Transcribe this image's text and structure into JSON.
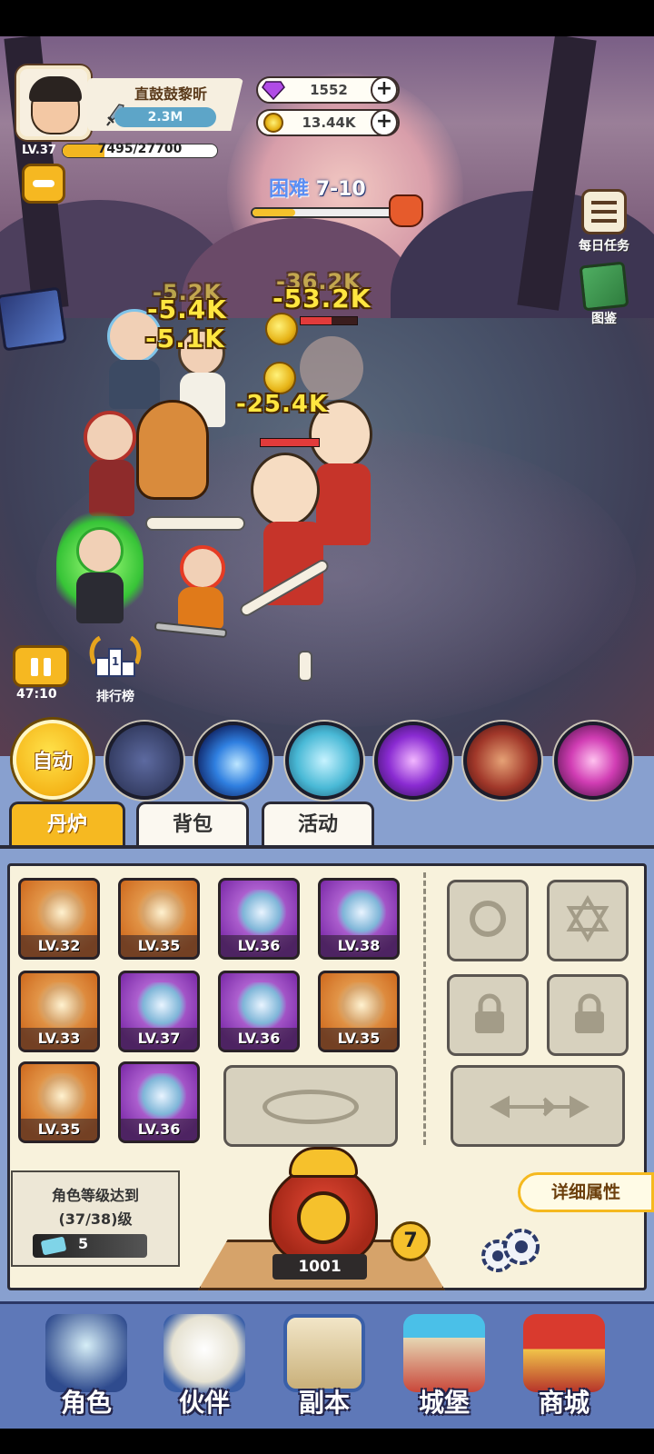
{
  "player": {
    "name": "直鼓鼓黎昕",
    "power": "2.3M",
    "level": "LV.37",
    "exp": "7495/27700",
    "exp_fraction": 0.27
  },
  "resources": {
    "gems": "1552",
    "coins": "13.44K"
  },
  "stage": {
    "difficulty": "困难",
    "number": "7-10",
    "progress_fraction": 0.3
  },
  "side_menu": {
    "daily_tasks": "每日任务",
    "codex": "图鉴"
  },
  "battle": {
    "damage_numbers": [
      "-5.2K",
      "-5.4K",
      "-5.1K",
      "-36.2K",
      "-53.2K",
      "-25.4K"
    ],
    "timer": "47:10",
    "rank_label": "排行榜"
  },
  "skills": {
    "auto_label": "自动",
    "icons": [
      "lightning-rune-icon",
      "blue-comet-icon",
      "ice-qilin-icon",
      "purple-vortex-icon",
      "wolf-beast-icon",
      "pink-spiral-icon"
    ]
  },
  "tabs": [
    {
      "label": "丹炉",
      "active": true
    },
    {
      "label": "背包",
      "active": false
    },
    {
      "label": "活动",
      "active": false
    }
  ],
  "inventory": [
    {
      "level": "LV.32",
      "rarity": "orange",
      "icon": "sword-icon"
    },
    {
      "level": "LV.35",
      "rarity": "orange",
      "icon": "scroll-creature-icon"
    },
    {
      "level": "LV.36",
      "rarity": "purple",
      "icon": "robe-icon"
    },
    {
      "level": "LV.38",
      "rarity": "purple",
      "icon": "jade-orb-icon"
    },
    {
      "level": "LV.33",
      "rarity": "orange",
      "icon": "crown-icon"
    },
    {
      "level": "LV.37",
      "rarity": "purple",
      "icon": "swirl-shield-icon"
    },
    {
      "level": "LV.36",
      "rarity": "purple",
      "icon": "gourd-icon"
    },
    {
      "level": "LV.35",
      "rarity": "orange",
      "icon": "golden-fruit-icon"
    },
    {
      "level": "LV.35",
      "rarity": "orange",
      "icon": "butterfly-charm-icon"
    },
    {
      "level": "LV.36",
      "rarity": "purple",
      "icon": "boots-icon"
    }
  ],
  "furnace": {
    "requirement_line1": "角色等级达到",
    "requirement_line2": "(37/38)级",
    "ticket_count": "5",
    "count": "1001",
    "badge": "7",
    "detail_button": "详细属性"
  },
  "bottom_nav": [
    {
      "label": "角色",
      "icon": "character-icon"
    },
    {
      "label": "伙伴",
      "icon": "partner-icon"
    },
    {
      "label": "副本",
      "icon": "dungeon-scroll-icon"
    },
    {
      "label": "城堡",
      "icon": "castle-icon"
    },
    {
      "label": "商城",
      "icon": "shop-icon"
    }
  ],
  "colors": {
    "accent_gold": "#f6b921",
    "panel_cream": "#f8f2dc",
    "nav_blue": "#5e78b8",
    "rarity_orange": "#cf6a1e",
    "rarity_purple": "#7b2aa8"
  }
}
